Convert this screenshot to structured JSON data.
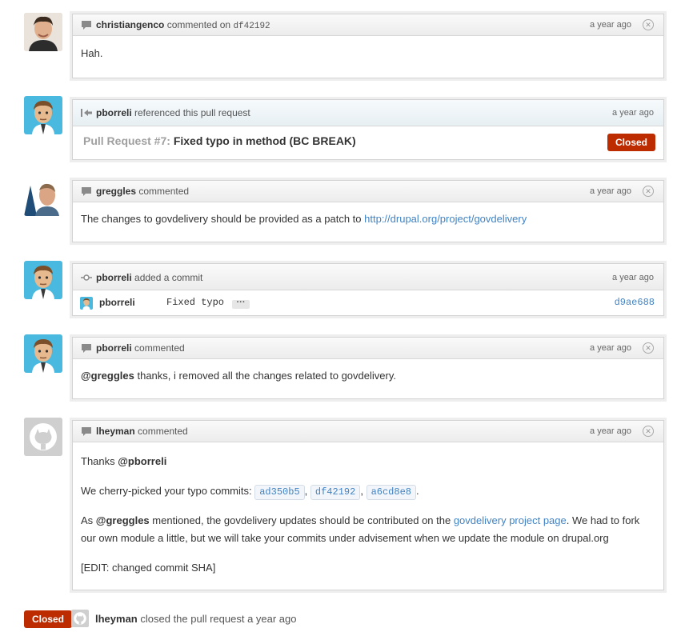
{
  "colors": {
    "link": "#4183c4",
    "closed": "#bd2c00"
  },
  "items": [
    {
      "type": "comment",
      "author": "christiangenco",
      "action": "commented on",
      "sha": "df42192",
      "time": "a year ago",
      "body": "Hah."
    },
    {
      "type": "reference",
      "author": "pborreli",
      "action": "referenced this pull request",
      "time": "a year ago",
      "pr_label": "Pull Request #7:",
      "pr_title": "Fixed typo in method (BC BREAK)",
      "state": "Closed"
    },
    {
      "type": "comment",
      "author": "greggles",
      "action": "commented",
      "time": "a year ago",
      "body_text": "The changes to govdelivery should be provided as a patch to",
      "body_link": "http://drupal.org/project/govdelivery"
    },
    {
      "type": "commit",
      "author": "pborreli",
      "action": "added a commit",
      "time": "a year ago",
      "commit_author": "pborreli",
      "commit_message": "Fixed typo",
      "commit_more": "···",
      "commit_sha": "d9ae688"
    },
    {
      "type": "comment",
      "author": "pborreli",
      "action": "commented",
      "time": "a year ago",
      "mention": "@greggles",
      "body_text": " thanks, i removed all the changes related to govdelivery."
    },
    {
      "type": "comment",
      "author": "lheyman",
      "action": "commented",
      "time": "a year ago",
      "p1_text": "Thanks ",
      "p1_mention": "@pborreli",
      "p2_text": "We cherry-picked your typo commits:",
      "p2_shas": [
        "ad350b5",
        "df42192",
        "a6cd8e8"
      ],
      "p2_sep": ",",
      "p2_end": ".",
      "p3_prefix": "As ",
      "p3_mention": "@greggles",
      "p3_mid": " mentioned, the govdelivery updates should be contributed on the ",
      "p3_link": "govdelivery project page",
      "p3_suffix": ". We had to fork our own module a little, but we will take your commits under advisement when we update the module on drupal.org",
      "p4_text": "[EDIT: changed commit SHA]"
    }
  ],
  "footer": {
    "state": "Closed",
    "author": "lheyman",
    "text": "closed the pull request a year ago"
  }
}
